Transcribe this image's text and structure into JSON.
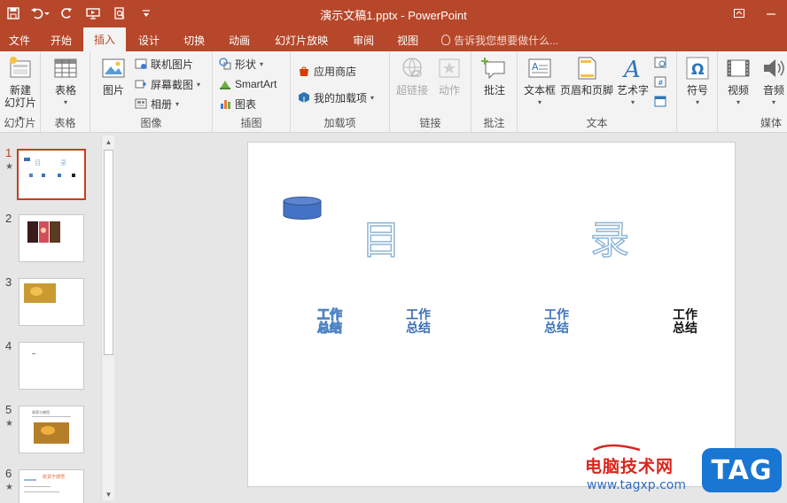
{
  "window": {
    "title": "演示文稿1.pptx - PowerPoint"
  },
  "tabs": [
    {
      "label": "文件"
    },
    {
      "label": "开始"
    },
    {
      "label": "插入",
      "active": true
    },
    {
      "label": "设计"
    },
    {
      "label": "切换"
    },
    {
      "label": "动画"
    },
    {
      "label": "幻灯片放映"
    },
    {
      "label": "审阅"
    },
    {
      "label": "视图"
    }
  ],
  "tellme": {
    "text": "告诉我您想要做什么..."
  },
  "ribbon": {
    "slides_group": {
      "label": "幻灯片",
      "new_slide": "新建",
      "new_slide2": "幻灯片"
    },
    "table_group": {
      "label": "表格",
      "table": "表格"
    },
    "images_group": {
      "label": "图像",
      "picture": "图片",
      "online_picture": "联机图片",
      "screenshot": "屏幕截图",
      "album": "相册"
    },
    "illustrations_group": {
      "label": "插图",
      "shapes": "形状",
      "smartart": "SmartArt",
      "chart": "图表"
    },
    "addins_group": {
      "label": "加载项",
      "store": "应用商店",
      "my_addins": "我的加载项"
    },
    "links_group": {
      "label": "链接",
      "hyperlink": "超链接",
      "action": "动作"
    },
    "comments_group": {
      "label": "批注",
      "comment": "批注"
    },
    "text_group": {
      "label": "文本",
      "textbox": "文本框",
      "header_footer": "页眉和页脚",
      "wordart": "艺术字"
    },
    "symbols_group": {
      "label": "符号",
      "symbol": "符号"
    },
    "media_group": {
      "label": "媒体",
      "video": "视频",
      "audio": "音频"
    }
  },
  "slides": [
    {
      "num": "1",
      "star": "★",
      "active": true,
      "thumb_text": "目 录"
    },
    {
      "num": "2",
      "star": ""
    },
    {
      "num": "3",
      "star": ""
    },
    {
      "num": "4",
      "star": ""
    },
    {
      "num": "5",
      "star": "★",
      "thumb_text": "收获与感悟"
    },
    {
      "num": "6",
      "star": "★",
      "thumb_text": "收货于感悟"
    }
  ],
  "slide_content": {
    "char1": "目",
    "char2": "录",
    "items": [
      {
        "line1": "工作",
        "line2": "总结"
      },
      {
        "line1": "工作",
        "line2": "总结"
      },
      {
        "line1": "工作",
        "line2": "总结"
      },
      {
        "line1": "工作",
        "line2": "总结"
      }
    ]
  },
  "watermark": {
    "text": "电脑技术网",
    "url": "www.tagxp.com",
    "badge": "TAG"
  },
  "colors": {
    "brand": "#b7472a",
    "ribbon_bg": "#f3f3f3",
    "active_slide_border": "#c43e1c"
  }
}
